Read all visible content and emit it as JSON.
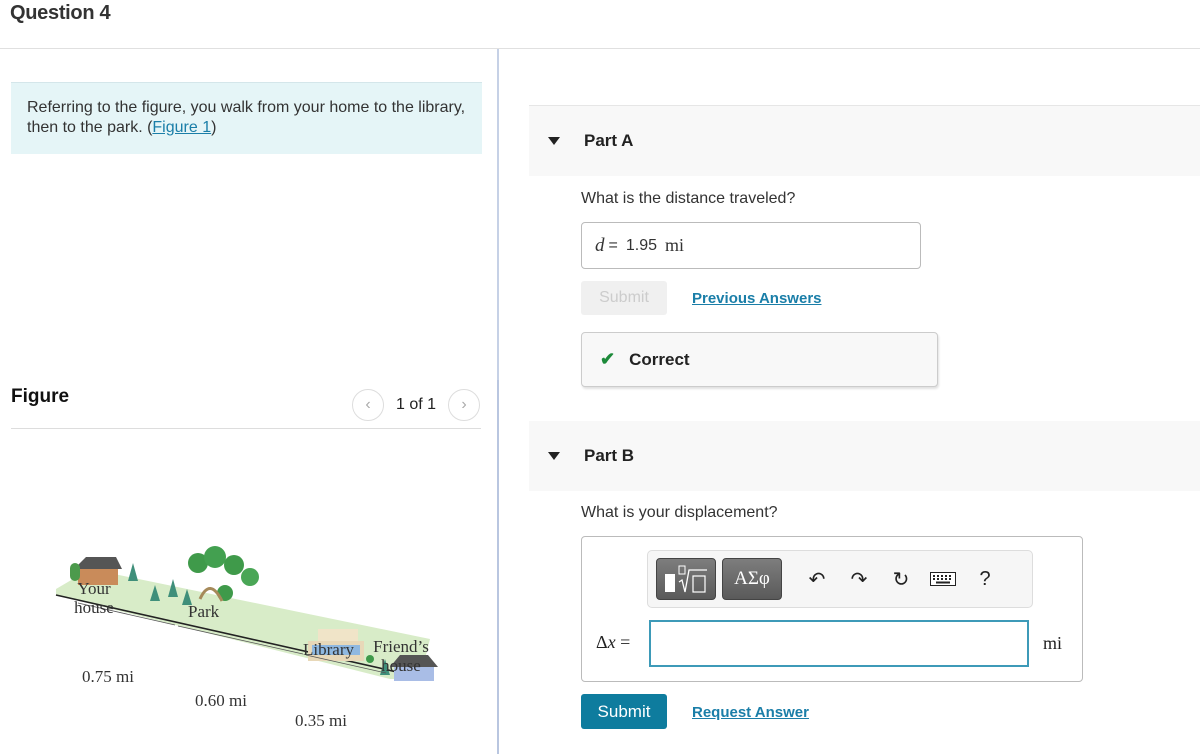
{
  "question": {
    "title": "Question 4"
  },
  "intro": {
    "text": "Referring to the figure, you walk from your home to the library, then to the park. (",
    "link": "Figure 1",
    "text_end": ")"
  },
  "figure": {
    "title": "Figure",
    "pager": {
      "text": "1 of 1",
      "prev_icon": "chevron-left",
      "next_icon": "chevron-right"
    },
    "labels": {
      "your_house": "Your house",
      "park": "Park",
      "library": "Library",
      "friends_house": "Friend’s house",
      "d1": "0.75 mi",
      "d2": "0.60 mi",
      "d3": "0.35 mi"
    }
  },
  "partA": {
    "title": "Part A",
    "question": "What is the distance traveled?",
    "answer": {
      "var": "d",
      "eq": "=",
      "value": "1.95",
      "unit": "mi"
    },
    "submit_label": "Submit",
    "previous_answers_label": "Previous Answers",
    "feedback": {
      "status": "Correct",
      "icon": "checkmark"
    }
  },
  "partB": {
    "title": "Part B",
    "question": "What is your displacement?",
    "toolbar": {
      "greek_label": "ΑΣφ",
      "help_label": "?"
    },
    "input": {
      "label_delta": "Δ",
      "label_var": "x",
      "label_eq": " =",
      "value": "",
      "unit": "mi"
    },
    "submit_label": "Submit",
    "request_answer_label": "Request Answer"
  }
}
